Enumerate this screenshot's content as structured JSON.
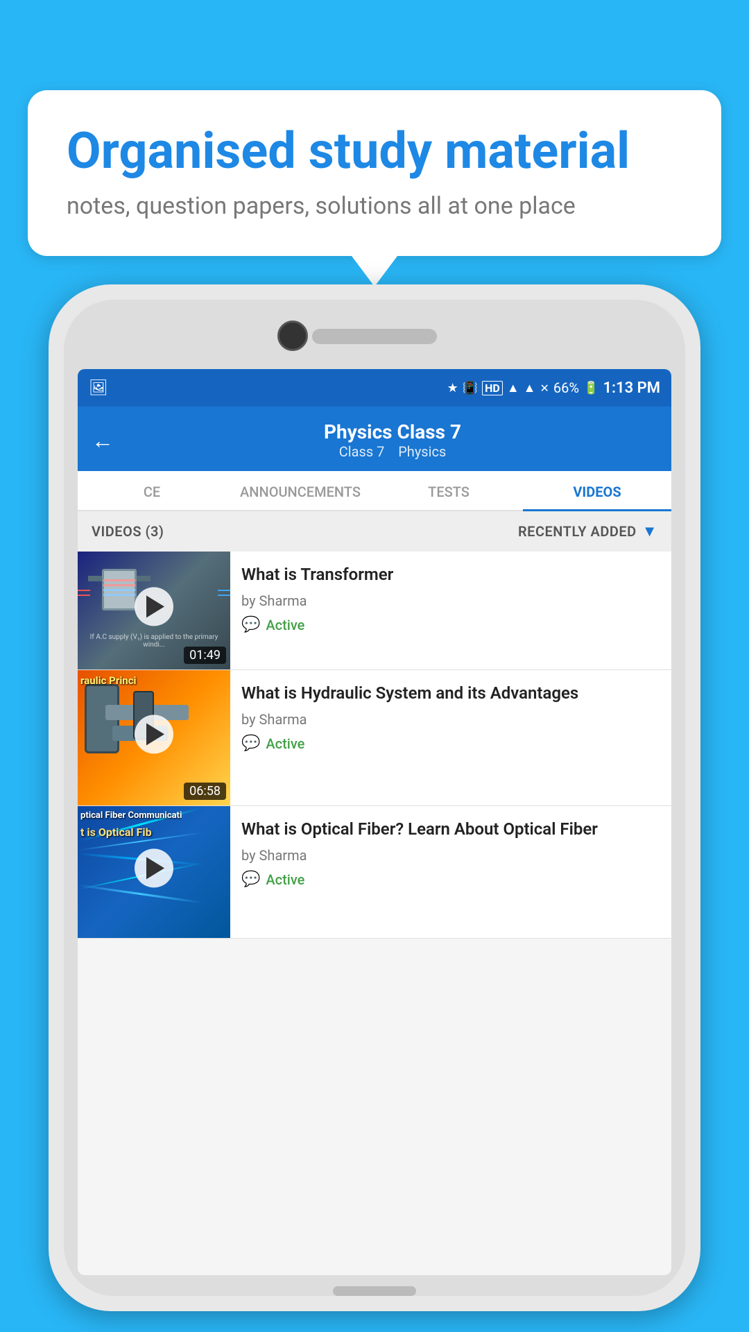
{
  "background": {
    "color": "#29b6f6"
  },
  "speech_bubble": {
    "title": "Organised study material",
    "subtitle": "notes, question papers, solutions all at one place"
  },
  "phone": {
    "status_bar": {
      "time": "1:13 PM",
      "battery": "66%",
      "icons": [
        "bluetooth",
        "vibrate",
        "HD",
        "wifi",
        "signal",
        "x-signal"
      ]
    },
    "app_bar": {
      "title": "Physics Class 7",
      "subtitle_class": "Class 7",
      "subtitle_subject": "Physics",
      "back_label": "←"
    },
    "tabs": [
      {
        "label": "CE",
        "active": false
      },
      {
        "label": "ANNOUNCEMENTS",
        "active": false
      },
      {
        "label": "TESTS",
        "active": false
      },
      {
        "label": "VIDEOS",
        "active": true
      }
    ],
    "filter": {
      "count_label": "VIDEOS (3)",
      "sort_label": "RECENTLY ADDED"
    },
    "videos": [
      {
        "title": "What is  Transformer",
        "author": "by Sharma",
        "status": "Active",
        "duration": "01:49",
        "thumbnail_type": "transformer"
      },
      {
        "title": "What is Hydraulic System and its Advantages",
        "author": "by Sharma",
        "status": "Active",
        "duration": "06:58",
        "thumbnail_type": "hydraulic",
        "thumb_text": "raulic Princi"
      },
      {
        "title": "What is Optical Fiber? Learn About Optical Fiber",
        "author": "by Sharma",
        "status": "Active",
        "duration": "",
        "thumbnail_type": "optical",
        "thumb_text1": "ptical Fiber Communicati",
        "thumb_text2": "t is Optical Fib"
      }
    ]
  }
}
